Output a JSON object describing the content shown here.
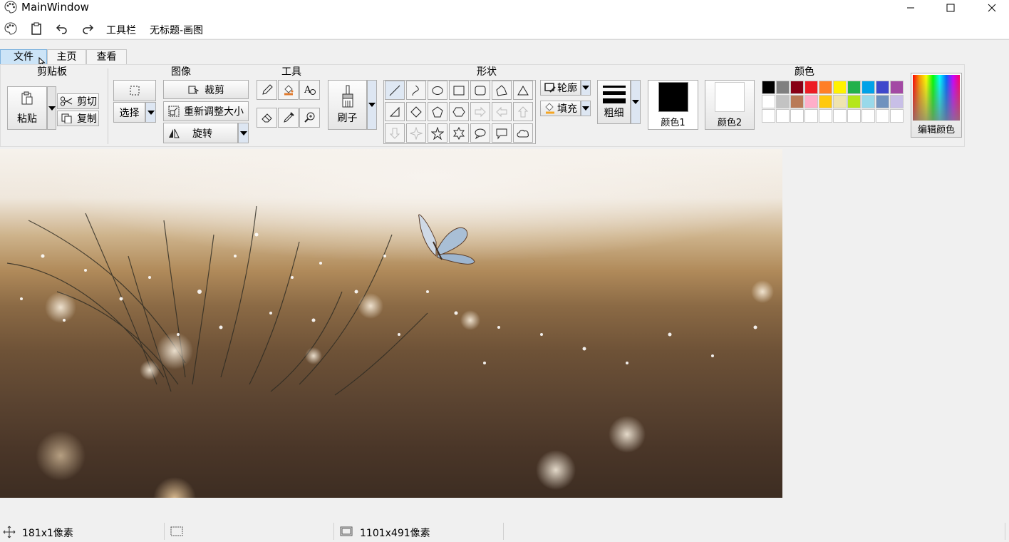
{
  "window": {
    "title": "MainWindow"
  },
  "quick_access": {
    "toolbar_label": "工具栏",
    "document_title": "无标题-画图"
  },
  "tabs": [
    {
      "label": "文件",
      "active": true
    },
    {
      "label": "主页",
      "active": false
    },
    {
      "label": "查看",
      "active": false
    }
  ],
  "clipboard": {
    "title": "剪贴板",
    "paste": "粘贴",
    "cut": "剪切",
    "copy": "复制"
  },
  "image": {
    "title": "图像",
    "select": "选择",
    "crop": "裁剪",
    "resize": "重新调整大小",
    "rotate": "旋转"
  },
  "tools": {
    "title": "工具",
    "brush": "刷子"
  },
  "shapes": {
    "title": "形状",
    "outline": "轮廓",
    "fill": "填充",
    "size": "粗细"
  },
  "colors": {
    "title": "颜色",
    "color1": "颜色1",
    "color2": "颜色2",
    "edit": "编辑颜色",
    "color1_value": "#000000",
    "color2_value": "#ffffff",
    "palette_row1": [
      "#000000",
      "#7f7f7f",
      "#880015",
      "#ed1c24",
      "#ff7f27",
      "#fff200",
      "#22b14c",
      "#00a2e8",
      "#3f48cc",
      "#a349a4"
    ],
    "palette_row2": [
      "#ffffff",
      "#c3c3c3",
      "#b97a57",
      "#ffaec9",
      "#ffc90e",
      "#efe4b0",
      "#b5e61d",
      "#99d9ea",
      "#7092be",
      "#c8bfe7"
    ],
    "palette_row3": [
      "#ffffff",
      "#ffffff",
      "#ffffff",
      "#ffffff",
      "#ffffff",
      "#ffffff",
      "#ffffff",
      "#ffffff",
      "#ffffff",
      "#ffffff"
    ]
  },
  "status": {
    "cursor_pos": "181x1像素",
    "selection_size": "",
    "image_size": "1101x491像素"
  }
}
